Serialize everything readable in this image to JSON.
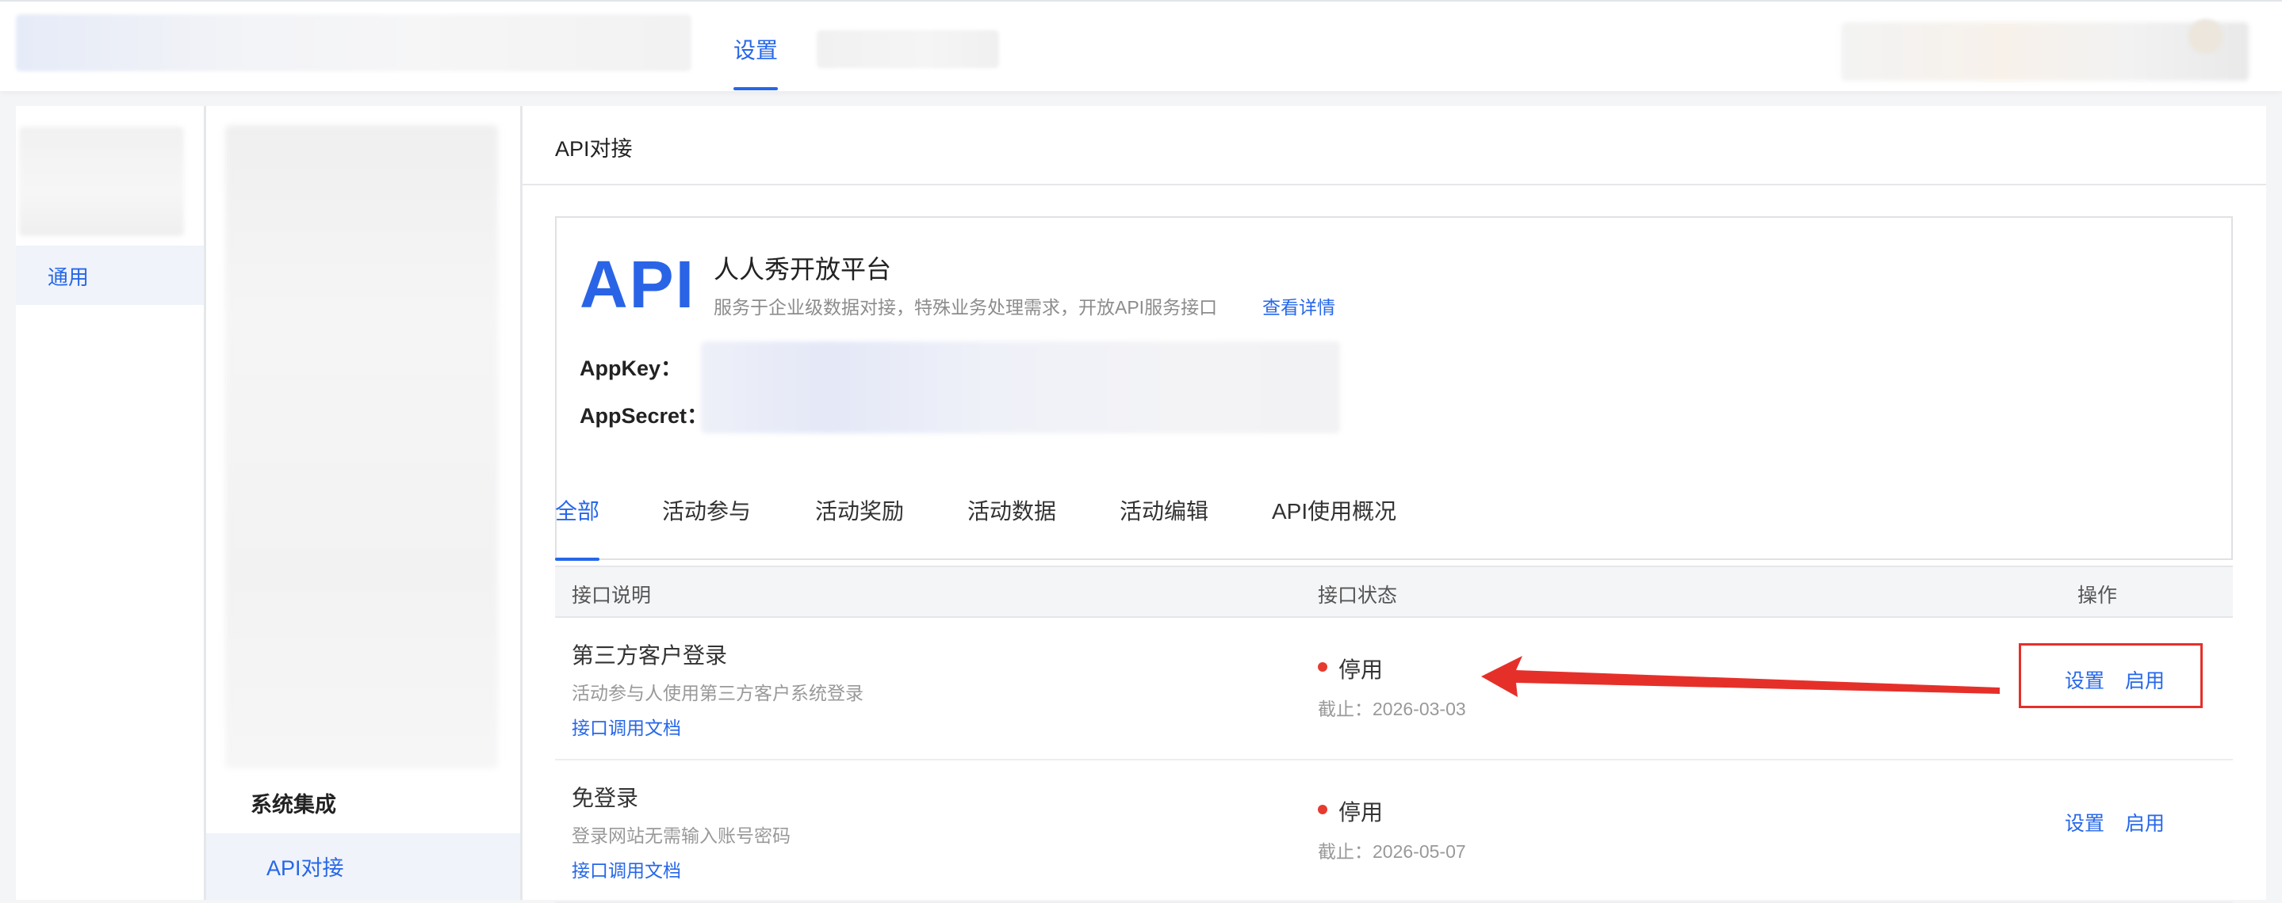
{
  "topbar": {
    "active_tab": "设置"
  },
  "sidebar1": {
    "items": [
      {
        "label": "通用"
      }
    ]
  },
  "sidebar2": {
    "group_title": "系统集成",
    "items": [
      {
        "label": "API对接"
      }
    ]
  },
  "main": {
    "header_title": "API对接",
    "card": {
      "logo_text": "API",
      "title": "人人秀开放平台",
      "description": "服务于企业级数据对接，特殊业务处理需求，开放API服务接口",
      "details_link": "查看详情",
      "appkey_label": "AppKey：",
      "appsecret_label": "AppSecret："
    },
    "tabs": [
      {
        "label": "全部",
        "active": true
      },
      {
        "label": "活动参与",
        "active": false
      },
      {
        "label": "活动奖励",
        "active": false
      },
      {
        "label": "活动数据",
        "active": false
      },
      {
        "label": "活动编辑",
        "active": false
      },
      {
        "label": "API使用概况",
        "active": false
      }
    ],
    "table": {
      "headers": [
        "接口说明",
        "接口状态",
        "操作"
      ],
      "rows": [
        {
          "name": "第三方客户登录",
          "desc": "活动参与人使用第三方客户系统登录",
          "doc_link": "接口调用文档",
          "status": "停用",
          "expiry": "截止：2026-03-03",
          "action_set": "设置",
          "action_enable": "启用"
        },
        {
          "name": "免登录",
          "desc": "登录网站无需输入账号密码",
          "doc_link": "接口调用文档",
          "status": "停用",
          "expiry": "截止：2026-05-07",
          "action_set": "设置",
          "action_enable": "启用"
        }
      ]
    }
  },
  "colors": {
    "accent": "#2667e8",
    "status_off": "#e63b2f",
    "annotation": "#e5302a"
  },
  "annotation": {
    "type": "arrow-with-highlight-box",
    "target": "row-0-actions"
  }
}
